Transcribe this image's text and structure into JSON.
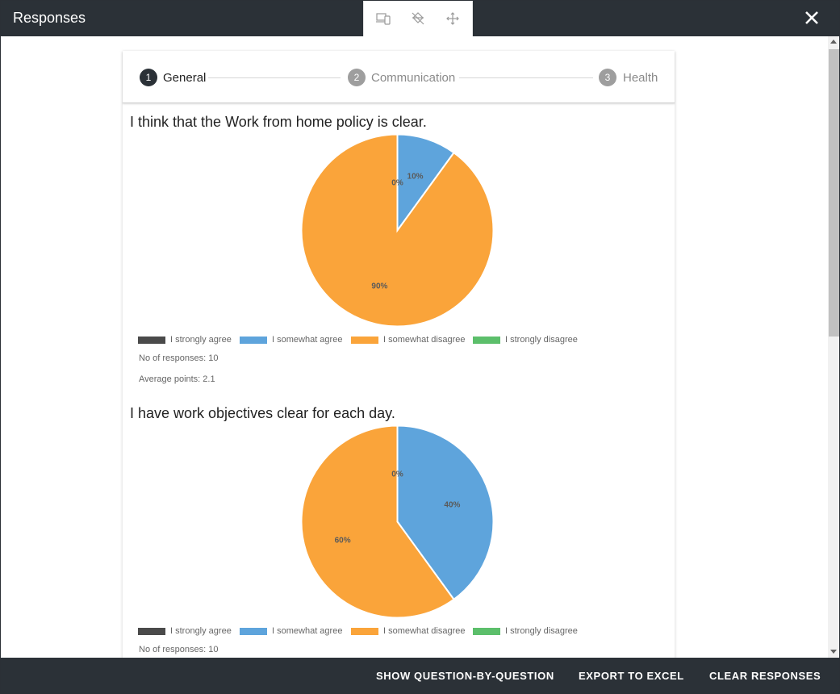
{
  "window": {
    "title": "Responses"
  },
  "toolbox": {
    "icons": [
      "devices-icon",
      "paint-bucket-icon",
      "move-icon"
    ]
  },
  "stepper": {
    "steps": [
      {
        "num": "1",
        "label": "General",
        "active": true
      },
      {
        "num": "2",
        "label": "Communication",
        "active": false
      },
      {
        "num": "3",
        "label": "Health",
        "active": false
      }
    ]
  },
  "legend": [
    {
      "label": "I strongly agree",
      "color": "#4a4a4a"
    },
    {
      "label": "I somewhat agree",
      "color": "#5ea4dc"
    },
    {
      "label": "I somewhat disagree",
      "color": "#faa43a"
    },
    {
      "label": "I strongly disagree",
      "color": "#5cbf6b"
    }
  ],
  "questions": [
    {
      "title": "I think that the Work from home policy is clear.",
      "responses": "No of responses: 10",
      "average": "Average points: 2.1"
    },
    {
      "title": "I have work objectives clear for each day.",
      "responses": "No of responses: 10"
    }
  ],
  "chart_data": [
    {
      "type": "pie",
      "title": "I think that the Work from home policy is clear.",
      "categories": [
        "I strongly agree",
        "I somewhat agree",
        "I somewhat disagree",
        "I strongly disagree"
      ],
      "values": [
        0,
        10,
        90,
        0
      ],
      "labels": [
        "0%",
        "10%",
        "90%"
      ],
      "colors": [
        "#4a4a4a",
        "#5ea4dc",
        "#faa43a",
        "#5cbf6b"
      ]
    },
    {
      "type": "pie",
      "title": "I have work objectives clear for each day.",
      "categories": [
        "I strongly agree",
        "I somewhat agree",
        "I somewhat disagree",
        "I strongly disagree"
      ],
      "values": [
        0,
        40,
        60,
        0
      ],
      "labels": [
        "0%",
        "40%",
        "60%"
      ],
      "colors": [
        "#4a4a4a",
        "#5ea4dc",
        "#faa43a",
        "#5cbf6b"
      ]
    }
  ],
  "footer": {
    "show_question": "SHOW QUESTION-BY-QUESTION",
    "export": "EXPORT TO EXCEL",
    "clear": "CLEAR RESPONSES"
  }
}
